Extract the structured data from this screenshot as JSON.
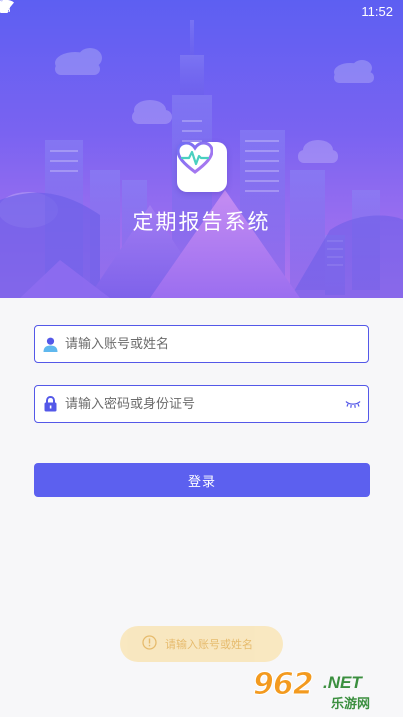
{
  "status_bar": {
    "time": "11:52",
    "icons": [
      "wifi-icon",
      "no-sim-icon",
      "battery-icon"
    ]
  },
  "app": {
    "title": "定期报告系统",
    "logo_icon": "heart-pulse-icon"
  },
  "form": {
    "account": {
      "value": "",
      "placeholder": "请输入账号或姓名",
      "icon": "user-icon"
    },
    "password": {
      "value": "",
      "placeholder": "请输入密码或身份证号",
      "icon": "lock-icon",
      "toggle_icon": "eye-closed-icon"
    },
    "login_label": "登录"
  },
  "toast": {
    "icon": "info-circle-icon",
    "message": "请输入账号或姓名"
  },
  "watermark": {
    "number": "962",
    "domain": ".NET",
    "site": "乐游网"
  },
  "colors": {
    "primary": "#5c60ef",
    "hero_top": "#5d5ff2",
    "hero_bottom": "#b277ee",
    "toast_bg": "#f9e7be",
    "toast_text": "#e6b866"
  }
}
